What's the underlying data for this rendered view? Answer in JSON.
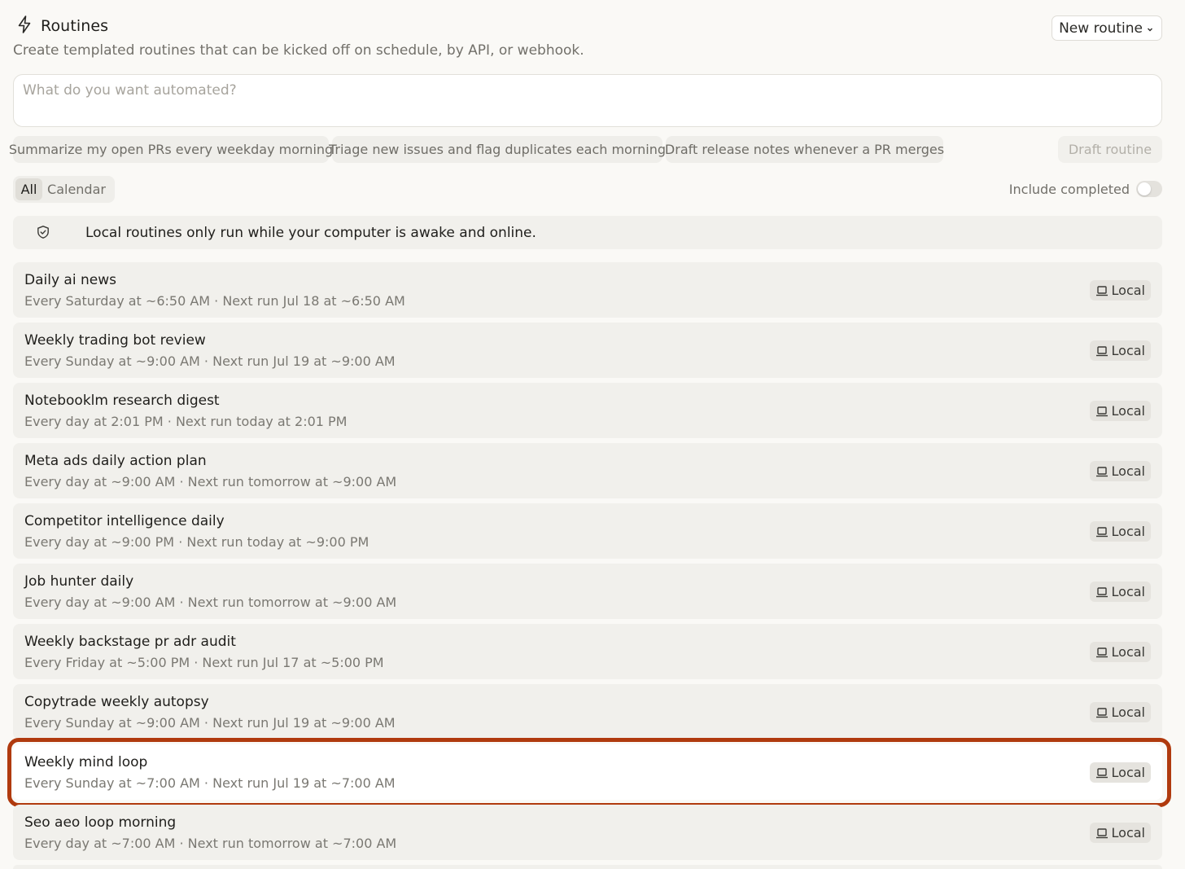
{
  "header": {
    "title": "Routines",
    "subtitle": "Create templated routines that can be kicked off on schedule, by API, or webhook.",
    "new_button": "New routine",
    "title_icon": "lightning-icon"
  },
  "prompt": {
    "placeholder": "What do you want automated?"
  },
  "suggestions": [
    "Summarize my open PRs every weekday morning",
    "Triage new issues and flag duplicates each morning",
    "Draft release notes whenever a PR merges"
  ],
  "draft_button": "Draft routine",
  "filters": {
    "tabs": [
      "All",
      "Calendar"
    ],
    "active_tab": "All",
    "include_completed_label": "Include completed",
    "include_completed": false
  },
  "notice": {
    "text": "Local routines only run while your computer is awake and online.",
    "icon": "shield-check-icon"
  },
  "routines": [
    {
      "name": "Daily ai news",
      "schedule": "Every Saturday at ~6:50 AM · Next run Jul 18 at ~6:50 AM",
      "badge": "Local"
    },
    {
      "name": "Weekly trading bot review",
      "schedule": "Every Sunday at ~9:00 AM · Next run Jul 19 at ~9:00 AM",
      "badge": "Local"
    },
    {
      "name": "Notebooklm research digest",
      "schedule": "Every day at 2:01 PM · Next run today at 2:01 PM",
      "badge": "Local"
    },
    {
      "name": "Meta ads daily action plan",
      "schedule": "Every day at ~9:00 AM · Next run tomorrow at ~9:00 AM",
      "badge": "Local"
    },
    {
      "name": "Competitor intelligence daily",
      "schedule": "Every day at ~9:00 PM · Next run today at ~9:00 PM",
      "badge": "Local"
    },
    {
      "name": "Job hunter daily",
      "schedule": "Every day at ~9:00 AM · Next run tomorrow at ~9:00 AM",
      "badge": "Local"
    },
    {
      "name": "Weekly backstage pr adr audit",
      "schedule": "Every Friday at ~5:00 PM · Next run Jul 17 at ~5:00 PM",
      "badge": "Local"
    },
    {
      "name": "Copytrade weekly autopsy",
      "schedule": "Every Sunday at ~9:00 AM · Next run Jul 19 at ~9:00 AM",
      "badge": "Local"
    },
    {
      "name": "Weekly mind loop",
      "schedule": "Every Sunday at ~7:00 AM · Next run Jul 19 at ~7:00 AM",
      "badge": "Local",
      "highlighted": true
    },
    {
      "name": "Seo aeo loop morning",
      "schedule": "Every day at ~7:00 AM · Next run tomorrow at ~7:00 AM",
      "badge": "Local"
    }
  ],
  "colors": {
    "highlight_ring": "#b03a0e",
    "row_background": "#f1f0ec",
    "page_background": "#faf9f6"
  }
}
